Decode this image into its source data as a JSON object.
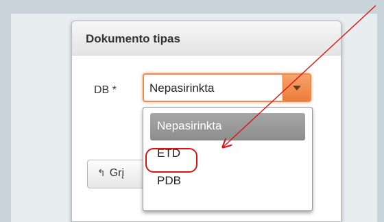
{
  "dialog": {
    "title": "Dokumento tipas",
    "field_label": "DB *",
    "select_value": "Nepasirinkta",
    "back_button_label": "Grį",
    "dropdown_options": [
      "Nepasirinkta",
      "ETD",
      "PDB"
    ]
  },
  "annotation": {
    "arrow_color": "#e01010",
    "circle_color": "#e01010"
  }
}
